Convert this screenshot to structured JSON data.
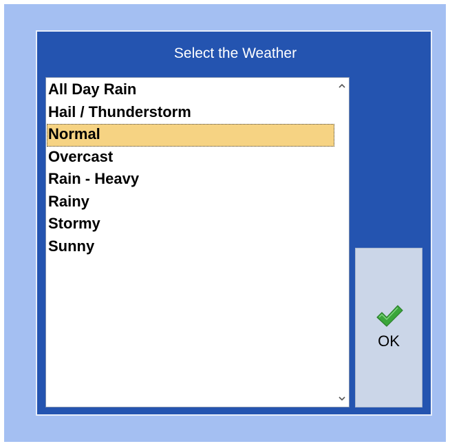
{
  "dialog": {
    "title": "Select the Weather"
  },
  "weather_list": {
    "items": [
      {
        "label": "All Day Rain",
        "selected": false
      },
      {
        "label": "Hail / Thunderstorm",
        "selected": false
      },
      {
        "label": "Normal",
        "selected": true
      },
      {
        "label": "Overcast",
        "selected": false
      },
      {
        "label": "Rain - Heavy",
        "selected": false
      },
      {
        "label": "Rainy",
        "selected": false
      },
      {
        "label": "Stormy",
        "selected": false
      },
      {
        "label": "Sunny",
        "selected": false
      }
    ],
    "scroll_up_icon": "chevron-up-icon",
    "scroll_down_icon": "chevron-down-icon"
  },
  "ok_button": {
    "label": "OK",
    "icon": "green-checkmark-icon"
  },
  "colors": {
    "backdrop": "#a4bff2",
    "dialog_background": "#2454b0",
    "selection_highlight": "#f6d383",
    "ok_button_background": "#cbd6e8",
    "checkmark_green": "#3aa63a"
  }
}
